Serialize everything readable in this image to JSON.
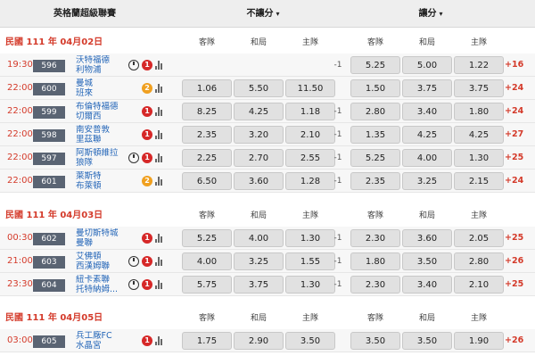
{
  "header": {
    "league": "英格蘭超級聯賽",
    "no_handicap": "不讓分",
    "handicap": "讓分",
    "caret": "▾"
  },
  "col_labels": {
    "away": "客隊",
    "draw": "和局",
    "home": "主隊"
  },
  "sections": [
    {
      "date": "民國 111 年 04月02日",
      "matches": [
        {
          "time": "19:30",
          "code": "596",
          "away": "沃特福德",
          "home": "利物浦",
          "clock": true,
          "badge": "1",
          "badge_color": "red",
          "odds": [
            "",
            "",
            ""
          ],
          "hcp": "-1",
          "hcp_odds": [
            "5.25",
            "5.00",
            "1.22"
          ],
          "more": "+16"
        },
        {
          "time": "22:00",
          "code": "600",
          "away": "曼城",
          "home": "班來",
          "clock": false,
          "badge": "2",
          "badge_color": "orange",
          "odds": [
            "1.06",
            "5.50",
            "11.50"
          ],
          "hcp": "",
          "hcp_odds": [
            "1.50",
            "3.75",
            "3.75"
          ],
          "more": "+24"
        },
        {
          "time": "22:00",
          "code": "599",
          "away": "布倫特福德",
          "home": "切爾西",
          "clock": false,
          "badge": "1",
          "badge_color": "red",
          "odds": [
            "8.25",
            "4.25",
            "1.18"
          ],
          "hcp": "-1",
          "hcp_odds": [
            "2.80",
            "3.40",
            "1.80"
          ],
          "more": "+24"
        },
        {
          "time": "22:00",
          "code": "598",
          "away": "南安普敦",
          "home": "里茲聯",
          "clock": false,
          "badge": "1",
          "badge_color": "red",
          "odds": [
            "2.35",
            "3.20",
            "2.10"
          ],
          "hcp": "-1",
          "hcp_odds": [
            "1.35",
            "4.25",
            "4.25"
          ],
          "more": "+27"
        },
        {
          "time": "22:00",
          "code": "597",
          "away": "阿斯頓維拉",
          "home": "狼隊",
          "clock": true,
          "badge": "1",
          "badge_color": "red",
          "odds": [
            "2.25",
            "2.70",
            "2.55"
          ],
          "hcp": "-1",
          "hcp_odds": [
            "5.25",
            "4.00",
            "1.30"
          ],
          "more": "+25"
        },
        {
          "time": "22:00",
          "code": "601",
          "away": "萊斯特",
          "home": "布萊頓",
          "clock": false,
          "badge": "2",
          "badge_color": "orange",
          "odds": [
            "6.50",
            "3.60",
            "1.28"
          ],
          "hcp": "-1",
          "hcp_odds": [
            "2.35",
            "3.25",
            "2.15"
          ],
          "more": "+24"
        }
      ]
    },
    {
      "date": "民國 111 年 04月03日",
      "matches": [
        {
          "time": "00:30",
          "code": "602",
          "away": "曼切斯特城",
          "home": "曼聯",
          "clock": false,
          "badge": "1",
          "badge_color": "red",
          "odds": [
            "5.25",
            "4.00",
            "1.30"
          ],
          "hcp": "-1",
          "hcp_odds": [
            "2.30",
            "3.60",
            "2.05"
          ],
          "more": "+25"
        },
        {
          "time": "21:00",
          "code": "603",
          "away": "艾佛頓",
          "home": "西漢姆聯",
          "clock": true,
          "badge": "1",
          "badge_color": "red",
          "odds": [
            "4.00",
            "3.25",
            "1.55"
          ],
          "hcp": "-1",
          "hcp_odds": [
            "1.80",
            "3.50",
            "2.80"
          ],
          "more": "+26"
        },
        {
          "time": "23:30",
          "code": "604",
          "away": "紐卡素聯",
          "home": "托特納姆...",
          "clock": true,
          "badge": "1",
          "badge_color": "red",
          "odds": [
            "5.75",
            "3.75",
            "1.30"
          ],
          "hcp": "-1",
          "hcp_odds": [
            "2.30",
            "3.40",
            "2.10"
          ],
          "more": "+25"
        }
      ]
    },
    {
      "date": "民國 111 年 04月05日",
      "matches": [
        {
          "time": "03:00",
          "code": "605",
          "away": "兵工廠FC",
          "home": "水晶宮",
          "clock": false,
          "badge": "1",
          "badge_color": "red",
          "odds": [
            "1.75",
            "2.90",
            "3.50"
          ],
          "hcp": "",
          "hcp_odds": [
            "3.50",
            "3.50",
            "1.90"
          ],
          "more": "+26"
        }
      ]
    }
  ]
}
